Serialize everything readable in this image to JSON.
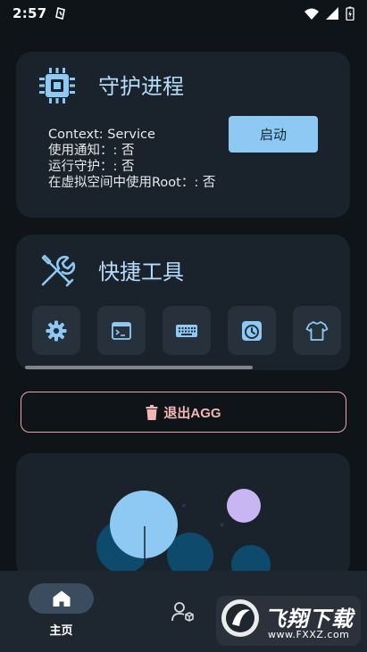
{
  "status_bar": {
    "time": "2:57"
  },
  "guard_card": {
    "title": "守护进程",
    "icon": "cpu-chip-icon",
    "info": [
      "Context: Service",
      "使用通知：: 否",
      "运行守护：: 否",
      "在虚拟空间中使用Root：: 否"
    ],
    "start_label": "启动"
  },
  "tools_card": {
    "title": "快捷工具",
    "icon": "wrench-screwdriver-icon",
    "tools": [
      "gear-icon",
      "terminal-icon",
      "keyboard-icon",
      "clock-icon",
      "shirt-icon"
    ]
  },
  "exit": {
    "label": "退出AGG",
    "icon": "trash-icon",
    "color": "#f2b6b3"
  },
  "bottom_nav": {
    "home_label": "主页"
  },
  "watermark": {
    "text": "飞翔下载",
    "url": "www.FXXZ.com"
  },
  "colors": {
    "background": "#0f1419",
    "card": "#1a222b",
    "accent": "#8ec9f4",
    "title": "#b6dcfb"
  }
}
